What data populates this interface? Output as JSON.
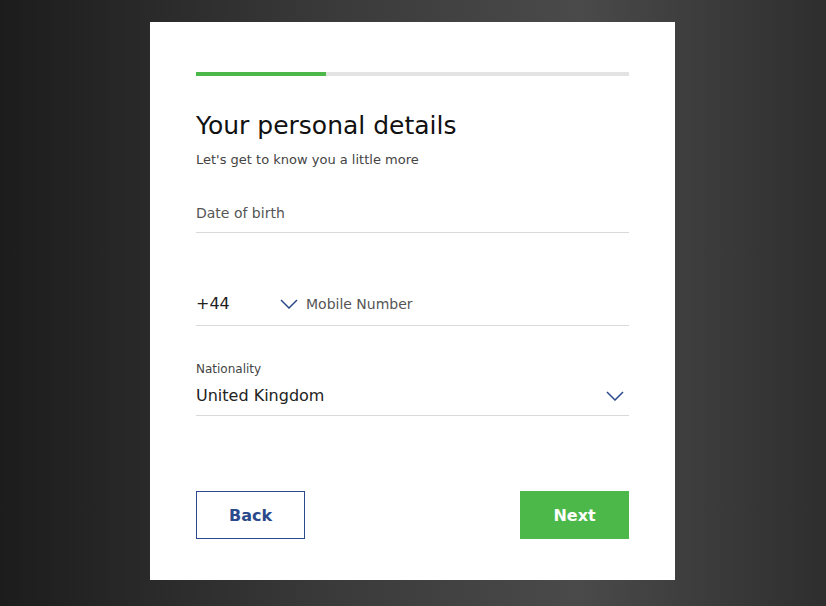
{
  "progress": {
    "level": 0.3
  },
  "title": "Your personal details",
  "subtitle": "Let's get to know you a little more",
  "fields": [
    {
      "kind": "text",
      "placeholder": "Date of birth"
    },
    {
      "kind": "phone",
      "code": "+44",
      "placeholder": "Mobile Number"
    },
    {
      "kind": "select",
      "label": "Nationality",
      "value": "United Kingdom"
    }
  ],
  "buttons": [
    {
      "label": "Back",
      "kind": "secondary"
    },
    {
      "label": "Next",
      "kind": "primary"
    }
  ]
}
